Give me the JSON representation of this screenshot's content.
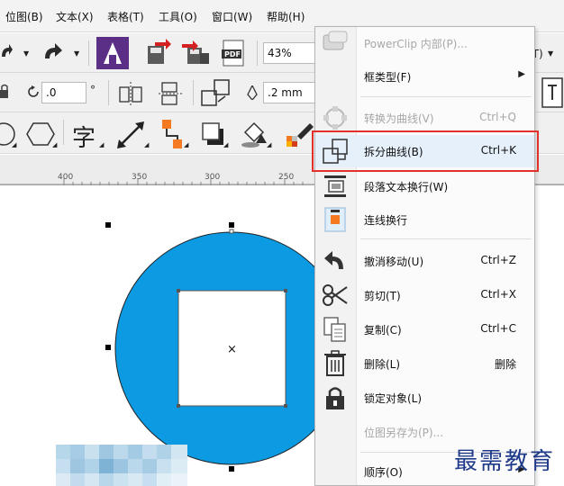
{
  "menubar": {
    "items": [
      "位图(B)",
      "文本(X)",
      "表格(T)",
      "工具(O)",
      "窗口(W)",
      "帮助(H)"
    ],
    "right_fragment": "(T)"
  },
  "toolbar": {
    "zoom_value": "43%",
    "rotation_value": ".0",
    "degree_symbol": "°",
    "outline_width": ".2 mm",
    "pdf_label": "PDF",
    "text_tool_glyph": "字"
  },
  "ruler": {
    "ticks": [
      "400",
      "350",
      "300",
      "250"
    ]
  },
  "canvas": {
    "circle_color": "#0c9ae3",
    "center_mark": "×"
  },
  "context_menu": {
    "items": [
      {
        "label": "PowerClip 内部(P)...",
        "shortcut": "",
        "enabled": false,
        "icon": "powerclip-icon"
      },
      {
        "label": "框类型(F)",
        "shortcut": "",
        "enabled": true,
        "icon": "",
        "submenu": true
      },
      {
        "label": "转换为曲线(V)",
        "shortcut": "Ctrl+Q",
        "enabled": false,
        "icon": "convert-curve-icon"
      },
      {
        "label": "拆分曲线(B)",
        "shortcut": "Ctrl+K",
        "enabled": true,
        "icon": "break-curve-icon",
        "highlighted": true
      },
      {
        "label": "段落文本换行(W)",
        "shortcut": "",
        "enabled": true,
        "icon": "paragraph-wrap-icon"
      },
      {
        "label": "连线换行",
        "shortcut": "",
        "enabled": true,
        "icon": "connector-wrap-icon"
      },
      {
        "label": "撤消移动(U)",
        "shortcut": "Ctrl+Z",
        "enabled": true,
        "icon": "undo-icon"
      },
      {
        "label": "剪切(T)",
        "shortcut": "Ctrl+X",
        "enabled": true,
        "icon": "scissors-icon"
      },
      {
        "label": "复制(C)",
        "shortcut": "Ctrl+C",
        "enabled": true,
        "icon": "copy-icon"
      },
      {
        "label": "删除(L)",
        "shortcut": "删除",
        "enabled": true,
        "icon": "trash-icon"
      },
      {
        "label": "锁定对象(L)",
        "shortcut": "",
        "enabled": true,
        "icon": "lock-icon"
      },
      {
        "label": "位图另存为(P)...",
        "shortcut": "",
        "enabled": false,
        "icon": ""
      },
      {
        "label": "顺序(O)",
        "shortcut": "",
        "enabled": true,
        "icon": "",
        "submenu": true
      }
    ]
  },
  "watermark": "最需教育",
  "colors": {
    "accent_red": "#e2312c",
    "highlight": "#e5f0fb",
    "circle": "#0c9ae3"
  }
}
